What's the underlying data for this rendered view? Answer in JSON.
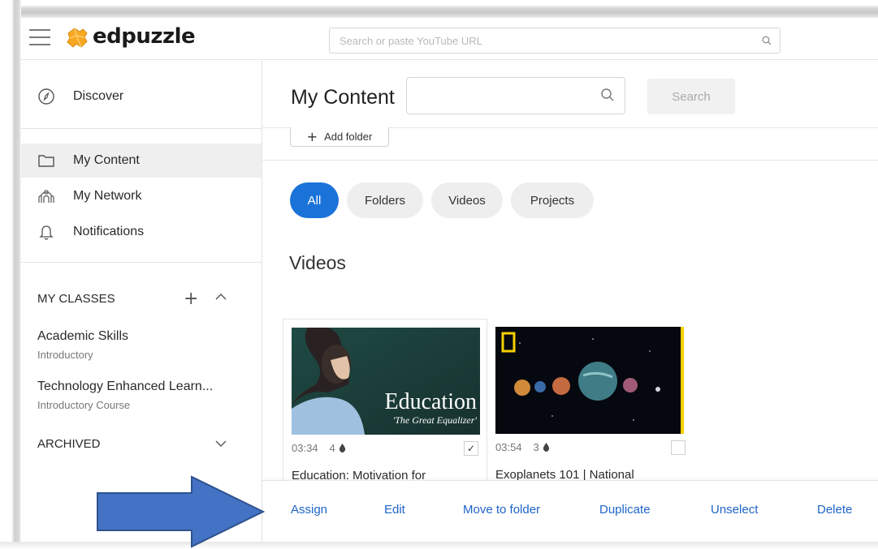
{
  "header": {
    "logo_text": "edpuzzle",
    "search_placeholder": "Search or paste YouTube URL"
  },
  "sidebar": {
    "discover": "Discover",
    "my_content": "My Content",
    "my_network": "My Network",
    "notifications": "Notifications",
    "classes_header": "MY CLASSES",
    "classes": [
      {
        "name": "Academic Skills",
        "sub": "Introductory"
      },
      {
        "name": "Technology Enhanced Learn...",
        "sub": "Introductory Course"
      }
    ],
    "archived": "ARCHIVED"
  },
  "main": {
    "title": "My Content",
    "search_button": "Search",
    "add_folder": "Add folder",
    "filters": [
      "All",
      "Folders",
      "Videos",
      "Projects"
    ],
    "active_filter": "All",
    "section_title": "Videos",
    "videos": [
      {
        "duration": "03:34",
        "count": "4",
        "title": "Education: Motivation for",
        "thumb_title": "Education",
        "thumb_subtitle": "'The Great Equalizer'",
        "selected": true,
        "check": "✓"
      },
      {
        "duration": "03:54",
        "count": "3",
        "title": "Exoplanets 101 | National",
        "selected": false,
        "check": ""
      }
    ]
  },
  "action_bar": {
    "assign": "Assign",
    "edit": "Edit",
    "move": "Move to folder",
    "duplicate": "Duplicate",
    "unselect": "Unselect",
    "delete": "Delete"
  },
  "colors": {
    "accent": "#1a73d9",
    "link": "#1e64c8",
    "logo_orange": "#f7a823",
    "arrow_blue": "#4472c4"
  },
  "icons": [
    "hamburger-icon",
    "edpuzzle-logo-icon",
    "search-icon",
    "compass-icon",
    "folder-icon",
    "network-icon",
    "bell-icon",
    "plus-icon",
    "chevron-up-icon",
    "chevron-down-icon",
    "checkmark-icon",
    "arrow-overlay"
  ]
}
